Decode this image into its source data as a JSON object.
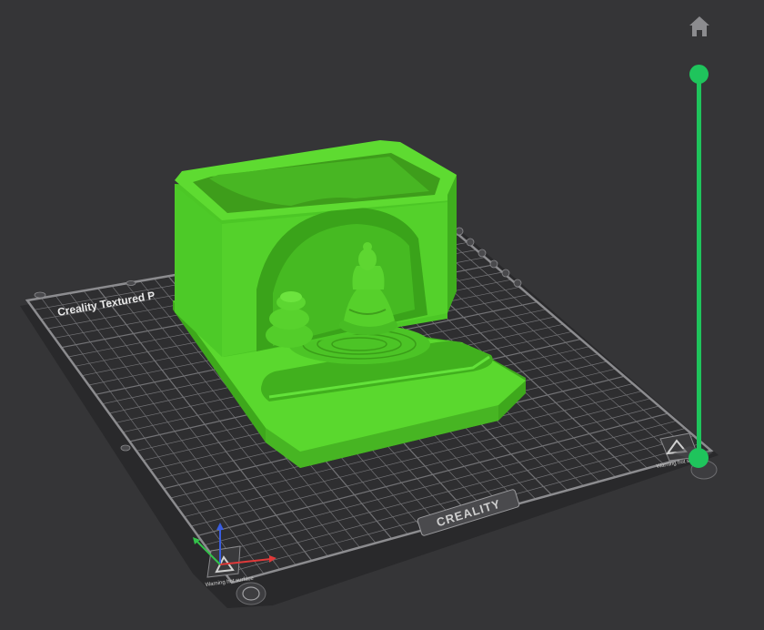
{
  "scene": {
    "background": "#353537",
    "model_color": "#55d42a",
    "bed_color": "#2b2b2d",
    "grid_color": "#77777a",
    "bed_label_left": "Creality Textured P",
    "brand_logo": "CREALITY",
    "warning_label_left": "Warning hot surface",
    "warning_label_right": "Warning hot surface"
  },
  "controls": {
    "home_icon": "home-icon",
    "layer_slider": {
      "color": "#1fc45c",
      "upper_fraction": 1.0,
      "lower_fraction": 0.0
    }
  },
  "axes": {
    "x_color": "#e03a3a",
    "y_color": "#33c14a",
    "z_color": "#3a5de0"
  }
}
